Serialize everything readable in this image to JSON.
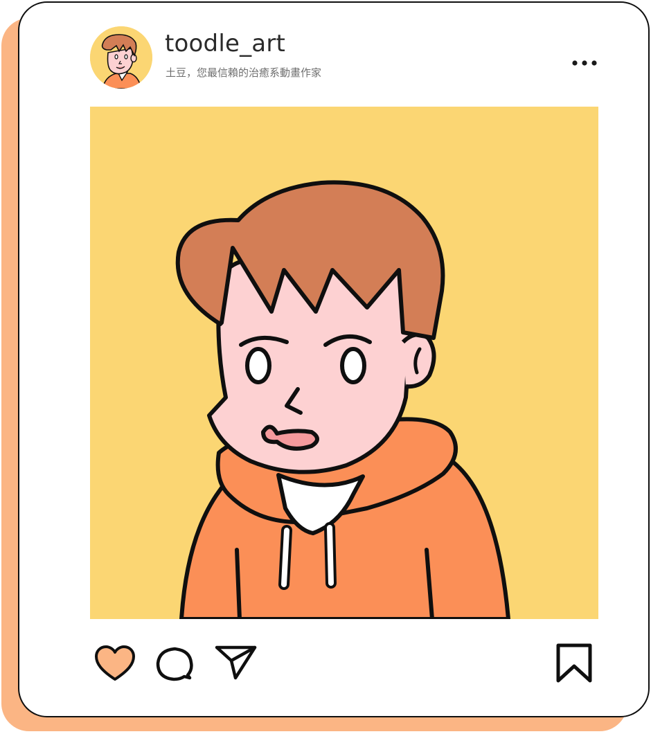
{
  "post": {
    "username": "toodle_art",
    "bio": "土豆，您最信賴的治癒系動畫作家"
  },
  "icons": {
    "more": "more-horizontal-icon",
    "like": "heart-icon",
    "comment": "comment-bubble-icon",
    "share": "paper-plane-icon",
    "save": "bookmark-icon"
  },
  "colors": {
    "shadow": "#fbb584",
    "image_background": "#fbd673",
    "hair": "#d37e56",
    "skin": "#fdd1d2",
    "hoodie": "#fb8f57",
    "heart_fill": "#fbb584",
    "outline": "#0f0f0f"
  }
}
